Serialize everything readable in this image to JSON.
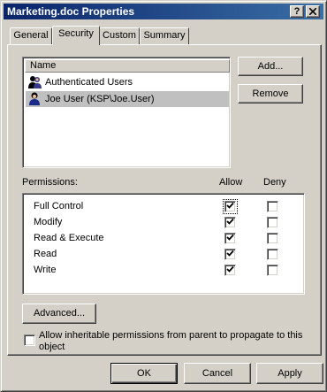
{
  "window": {
    "title": "Marketing.doc Properties",
    "help_glyph": "?",
    "close_glyph": "✕"
  },
  "tabs": [
    {
      "label": "General",
      "active": false
    },
    {
      "label": "Security",
      "active": true
    },
    {
      "label": "Custom",
      "active": false
    },
    {
      "label": "Summary",
      "active": false
    }
  ],
  "names": {
    "column_header": "Name",
    "items": [
      {
        "label": "Authenticated Users",
        "icon": "group-icon",
        "selected": false
      },
      {
        "label": "Joe User (KSP\\Joe.User)",
        "icon": "user-icon",
        "selected": true
      }
    ]
  },
  "buttons": {
    "add": "Add...",
    "remove": "Remove",
    "advanced": "Advanced...",
    "ok": "OK",
    "cancel": "Cancel",
    "apply": "Apply"
  },
  "permissions": {
    "title": "Permissions:",
    "allow_header": "Allow",
    "deny_header": "Deny",
    "items": [
      {
        "label": "Full Control",
        "allow": true,
        "deny": false
      },
      {
        "label": "Modify",
        "allow": true,
        "deny": false
      },
      {
        "label": "Read & Execute",
        "allow": true,
        "deny": false
      },
      {
        "label": "Read",
        "allow": true,
        "deny": false
      },
      {
        "label": "Write",
        "allow": true,
        "deny": false
      }
    ]
  },
  "inherit": {
    "label": "Allow inheritable permissions from parent to propagate to this object",
    "checked": false
  },
  "colors": {
    "titlebar_start": "#0a246a",
    "titlebar_end": "#3a6ea5",
    "face": "#d4d0c8",
    "selection": "#c0c0c0"
  }
}
